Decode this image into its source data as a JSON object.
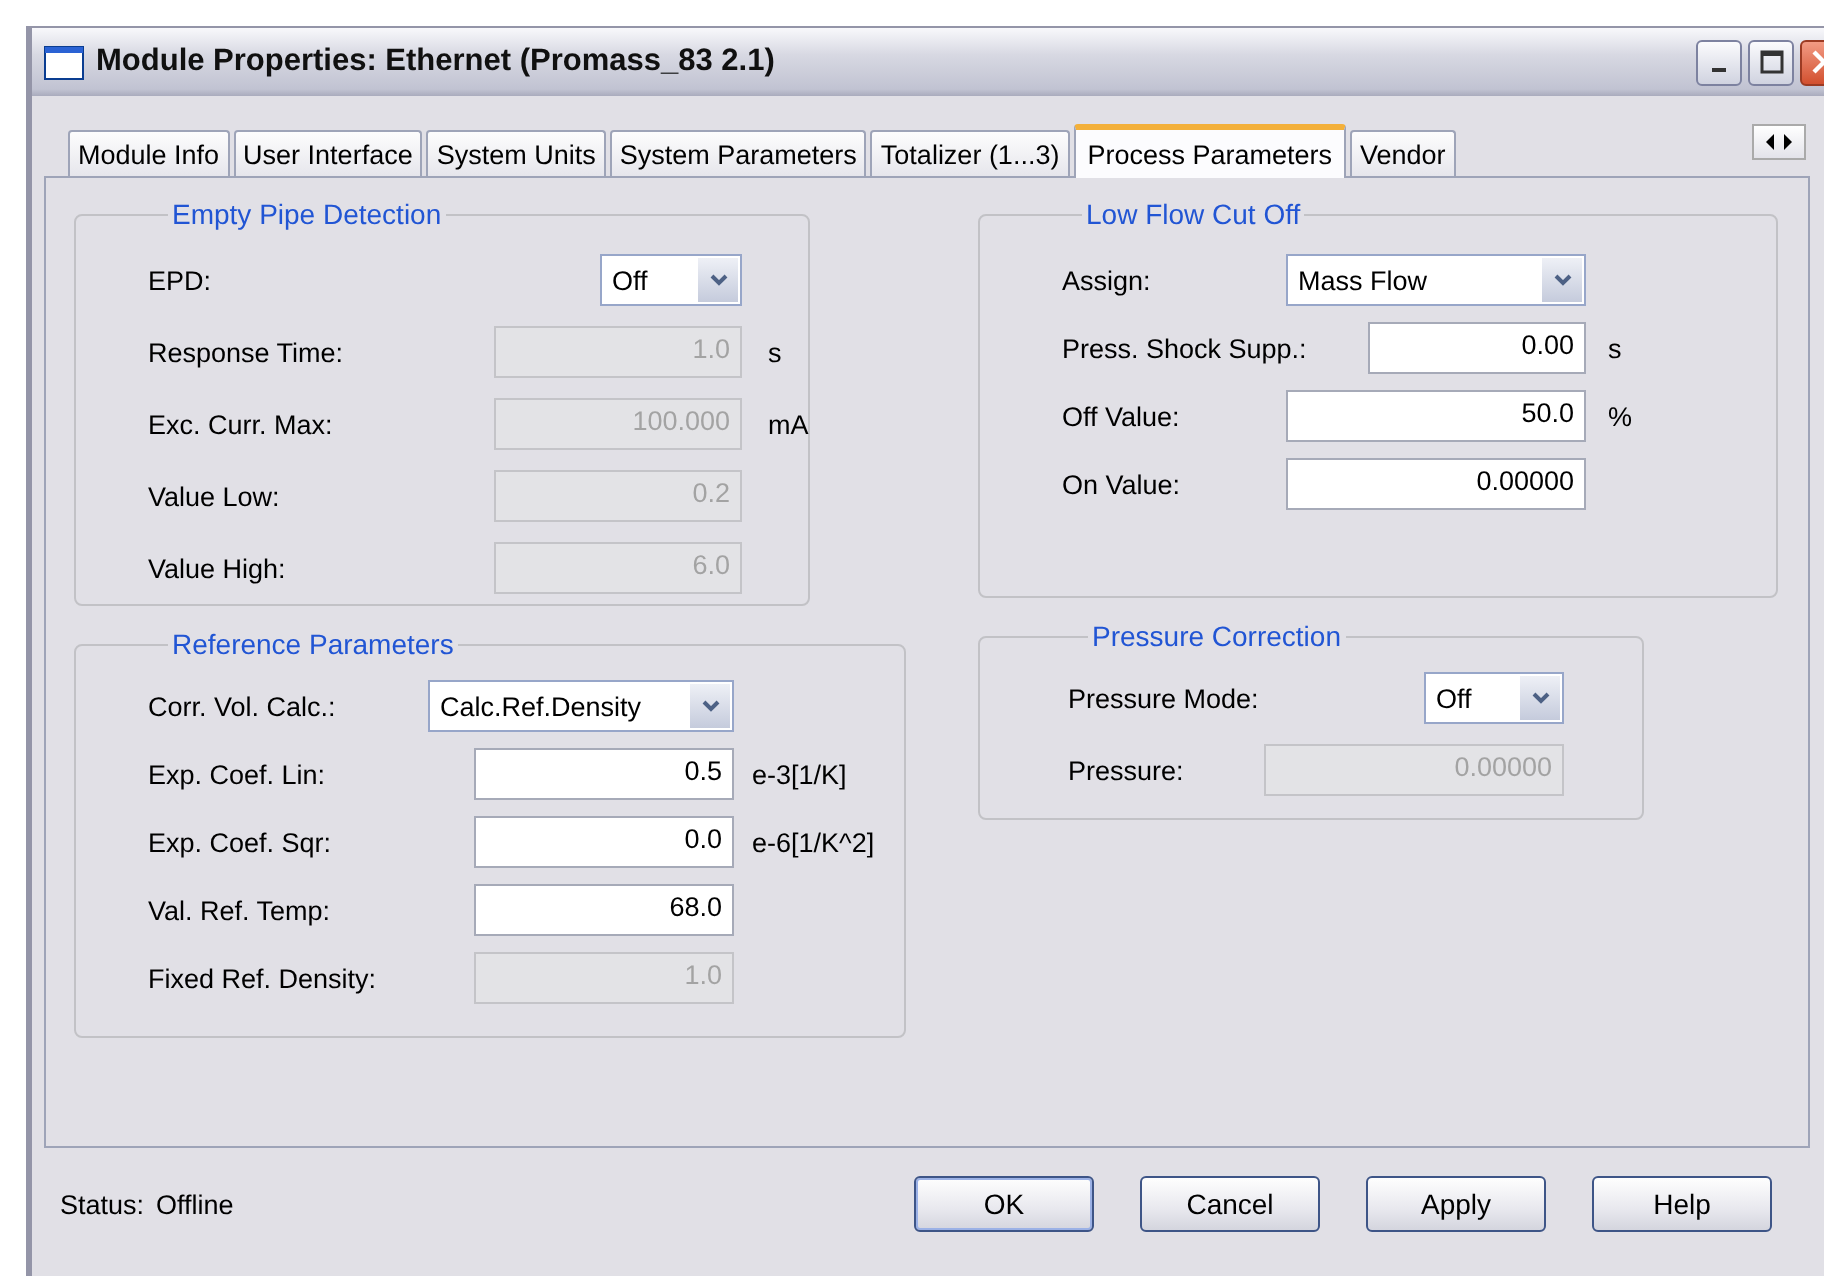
{
  "window": {
    "title": "Module Properties: Ethernet (Promass_83 2.1)"
  },
  "tabs": [
    {
      "label": "Module Info",
      "selected": false
    },
    {
      "label": "User Interface",
      "selected": false
    },
    {
      "label": "System Units",
      "selected": false
    },
    {
      "label": "System Parameters",
      "selected": false
    },
    {
      "label": "Totalizer (1...3)",
      "selected": false
    },
    {
      "label": "Process Parameters",
      "selected": true
    },
    {
      "label": "Vendor",
      "selected": false
    }
  ],
  "groups": [
    {
      "title": "Empty Pipe Detection",
      "fields": [
        {
          "label": "EPD:",
          "kind": "combo",
          "value": "Off",
          "disabled": false
        },
        {
          "label": "Response Time:",
          "kind": "text",
          "value": "1.0",
          "unit": "s",
          "disabled": true
        },
        {
          "label": "Exc. Curr. Max:",
          "kind": "text",
          "value": "100.000",
          "unit": "mA",
          "disabled": true
        },
        {
          "label": "Value Low:",
          "kind": "text",
          "value": "0.2",
          "disabled": true
        },
        {
          "label": "Value High:",
          "kind": "text",
          "value": "6.0",
          "disabled": true
        }
      ]
    },
    {
      "title": "Low Flow Cut Off",
      "fields": [
        {
          "label": "Assign:",
          "kind": "combo",
          "value": "Mass Flow",
          "disabled": false
        },
        {
          "label": "Press. Shock Supp.:",
          "kind": "text",
          "value": "0.00",
          "unit": "s",
          "disabled": false
        },
        {
          "label": "Off Value:",
          "kind": "text",
          "value": "50.0",
          "unit": "%",
          "disabled": false
        },
        {
          "label": "On Value:",
          "kind": "text",
          "value": "0.00000",
          "disabled": false
        }
      ]
    },
    {
      "title": "Reference Parameters",
      "fields": [
        {
          "label": "Corr. Vol. Calc.:",
          "kind": "combo",
          "value": "Calc.Ref.Density",
          "disabled": false
        },
        {
          "label": "Exp. Coef. Lin:",
          "kind": "text",
          "value": "0.5",
          "unit": "e-3[1/K]",
          "disabled": false
        },
        {
          "label": "Exp. Coef. Sqr:",
          "kind": "text",
          "value": "0.0",
          "unit": "e-6[1/K^2]",
          "disabled": false
        },
        {
          "label": "Val. Ref. Temp:",
          "kind": "text",
          "value": "68.0",
          "disabled": false
        },
        {
          "label": "Fixed Ref. Density:",
          "kind": "text",
          "value": "1.0",
          "disabled": true
        }
      ]
    },
    {
      "title": "Pressure Correction",
      "fields": [
        {
          "label": "Pressure Mode:",
          "kind": "combo",
          "value": "Off",
          "disabled": false
        },
        {
          "label": "Pressure:",
          "kind": "text",
          "value": "0.00000",
          "disabled": true
        }
      ]
    }
  ],
  "status_bar": {
    "label": "Status:",
    "value": "Offline"
  },
  "buttons": [
    "OK",
    "Cancel",
    "Apply",
    "Help"
  ]
}
